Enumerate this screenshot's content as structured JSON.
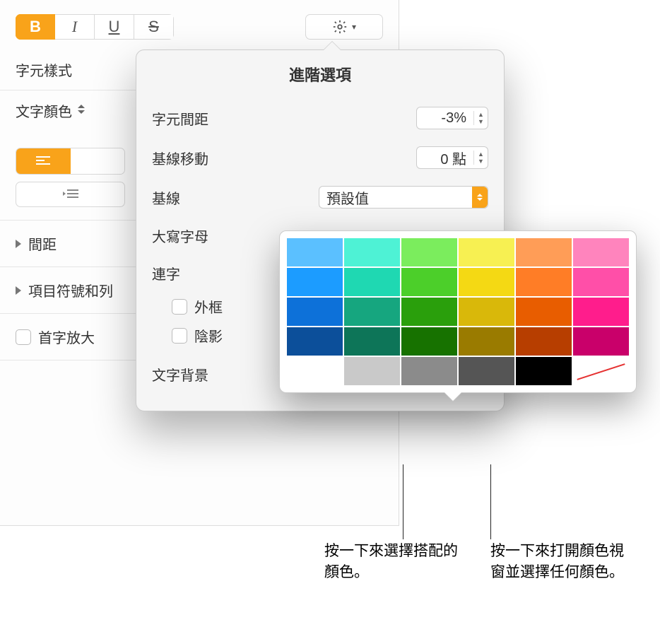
{
  "toolbar": {
    "bold": "B",
    "italic": "I",
    "underline": "U",
    "strike": "S"
  },
  "sidebar": {
    "char_style_label": "字元樣式",
    "text_color_label": "文字顏色",
    "spacing_label": "間距",
    "bullets_label": "項目符號和列",
    "drop_cap_label": "首字放大"
  },
  "popover": {
    "title": "進階選項",
    "char_spacing_label": "字元間距",
    "char_spacing_value": "-3%",
    "baseline_shift_label": "基線移動",
    "baseline_shift_value": "0 點",
    "baseline_label": "基線",
    "baseline_select": "預設值",
    "caps_label": "大寫字母",
    "ligatures_label": "連字",
    "outline_label": "外框",
    "shadow_label": "陰影",
    "text_bg_label": "文字背景"
  },
  "callouts": {
    "left": "按一下來選擇搭配的顏色。",
    "right": "按一下來打開顏色視窗並選擇任何顏色。"
  },
  "swatches": [
    [
      "#5bc0ff",
      "#4ef2d5",
      "#7bed5d",
      "#f7f052",
      "#ff9d57",
      "#ff84bd"
    ],
    [
      "#1c9cff",
      "#1fd8b2",
      "#4ccf2a",
      "#f4d914",
      "#ff7d26",
      "#ff4fa8"
    ],
    [
      "#0d71d9",
      "#16a67f",
      "#2a9f0c",
      "#d9b80a",
      "#e85d00",
      "#ff1d8c"
    ],
    [
      "#0c4f9a",
      "#0d7558",
      "#177200",
      "#9a7b00",
      "#b73e00",
      "#c9006a"
    ],
    [
      "#ffffff",
      "#c9c9c9",
      "#8b8b8b",
      "#555555",
      "#000000",
      "none"
    ]
  ]
}
